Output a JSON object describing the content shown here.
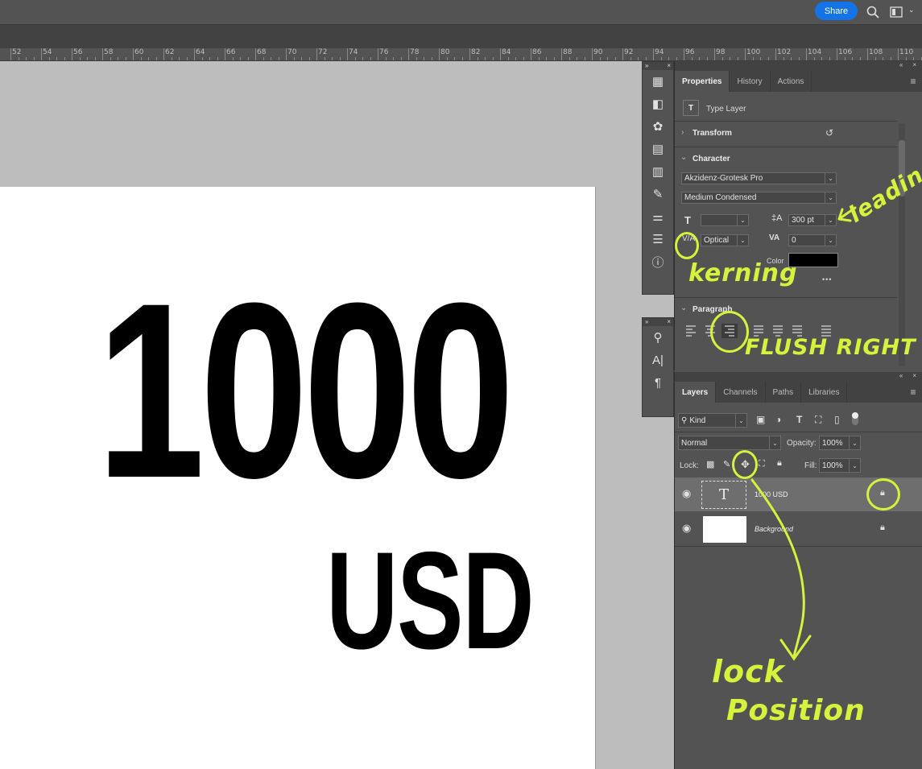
{
  "topbar": {
    "share_label": "Share"
  },
  "ruler": {
    "ticks": [
      "52",
      "54",
      "56",
      "58",
      "60",
      "62",
      "64",
      "66",
      "68",
      "70",
      "72",
      "74",
      "76",
      "78",
      "80",
      "82",
      "84",
      "86",
      "88",
      "90",
      "92",
      "94",
      "96",
      "98",
      "100",
      "102",
      "104",
      "106",
      "108",
      "110"
    ]
  },
  "canvas": {
    "main_text": "1000",
    "sub_text": "USD"
  },
  "properties": {
    "tabs": [
      "Properties",
      "History",
      "Actions"
    ],
    "layer_kind": "Type Layer",
    "transform_label": "Transform",
    "character_label": "Character",
    "font_family": "Akzidenz-Grotesk Pro",
    "font_style": "Medium Condensed",
    "font_size": "",
    "leading": "300 pt",
    "kerning": "Optical",
    "tracking": "0",
    "color_label": "Color",
    "color_value": "#000000",
    "more": "•••",
    "paragraph_label": "Paragraph"
  },
  "layers": {
    "tabs": [
      "Layers",
      "Channels",
      "Paths",
      "Libraries"
    ],
    "filter_kind": "Kind",
    "blend_mode": "Normal",
    "opacity_label": "Opacity:",
    "opacity_value": "100%",
    "lock_label": "Lock:",
    "fill_label": "Fill:",
    "fill_value": "100%",
    "items": [
      {
        "name": "1000 USD"
      },
      {
        "name": "Background"
      }
    ]
  },
  "annotations": {
    "leading": "leading",
    "kerning": "kerning",
    "flush_right": "FLUSH RIGHT",
    "lock_position_1": "lock",
    "lock_position_2": "Position"
  },
  "colors": {
    "accent": "#1473e6",
    "annotation": "#d6f23c",
    "panel": "#535353"
  }
}
